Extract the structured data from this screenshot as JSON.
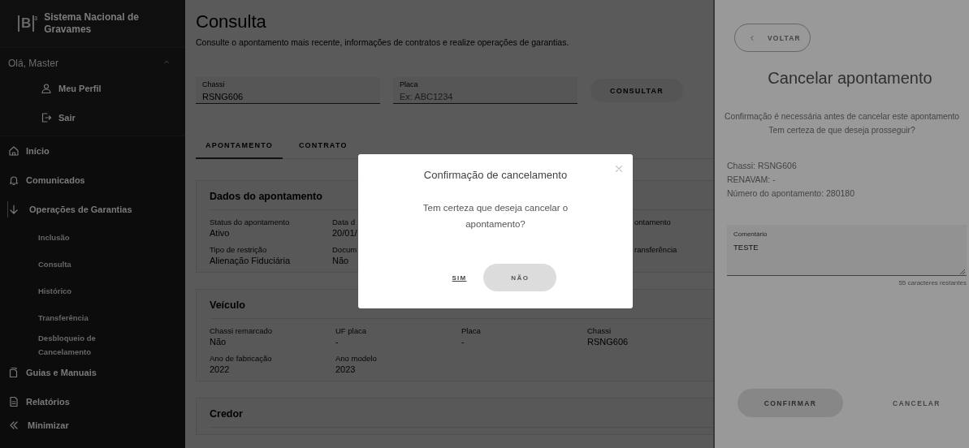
{
  "brand": {
    "logo_mark": "B",
    "logo_sup": "3",
    "name": "Sistema Nacional de Gravames"
  },
  "user": {
    "greeting": "Olá, Master",
    "expanded": true,
    "items": [
      {
        "label": "Meu Perfil"
      },
      {
        "label": "Sair"
      }
    ]
  },
  "nav": [
    {
      "label": "Início",
      "selected": false
    },
    {
      "label": "Comunicados",
      "selected": false
    },
    {
      "label": "Operações de Garantias",
      "selected": true,
      "children": [
        {
          "label": "Inclusão"
        },
        {
          "label": "Consulta"
        },
        {
          "label": "Histórico"
        },
        {
          "label": "Transferência"
        },
        {
          "label": "Desbloqueio de Cancelamento"
        }
      ]
    },
    {
      "label": "Guias e Manuais",
      "selected": false
    },
    {
      "label": "Relatórios",
      "selected": false
    }
  ],
  "minimize": "Minimizar",
  "main": {
    "title": "Consulta",
    "subtitle": "Consulte o apontamento mais recente, informações de contratos e realize operações de garantias.",
    "search_fields": [
      {
        "label": "Chassi",
        "value": "RSNG606"
      },
      {
        "label": "Placa",
        "placeholder": "Ex: ABC1234"
      }
    ],
    "search_button": "CONSULTAR",
    "tabs": [
      {
        "label": "APONTAMENTO",
        "selected": true
      },
      {
        "label": "CONTRATO",
        "selected": false
      }
    ],
    "cards": [
      {
        "title": "Dados do apontamento",
        "kind": "covered",
        "rows": [
          [
            {
              "label": "Status do apontamento",
              "value": "Ativo"
            },
            {
              "label": "Data d",
              "value": "20/01/"
            },
            {
              "label": "ontamento"
            }
          ],
          [
            {
              "label": "Tipo de restrição",
              "value": "Alienação Fiduciária"
            },
            {
              "label": "Docum",
              "value": "Não"
            },
            {
              "label": "ransferência"
            }
          ]
        ]
      },
      {
        "title": "Veículo",
        "kind": "full",
        "rows": [
          [
            {
              "label": "Chassi remarcado",
              "value": "Não"
            },
            {
              "label": "UF placa",
              "value": "-"
            },
            {
              "label": "Placa",
              "value": "-"
            },
            {
              "label": "Chassi",
              "value": "RSNG606"
            }
          ],
          [
            {
              "label": "Ano de fabricação",
              "value": "2022"
            },
            {
              "label": "Ano modelo",
              "value": "2023"
            }
          ]
        ]
      },
      {
        "title": "Credor",
        "kind": "full"
      }
    ]
  },
  "panel": {
    "back": "VOLTAR",
    "title": "Cancelar apontamento",
    "message": [
      "Confirmação é necessária antes de cancelar este apontamento",
      "Tem certeza de que deseja prosseguir?"
    ],
    "details": [
      "Chassi: RSNG606",
      "RENAVAM: -",
      "Número do apontamento: 280180"
    ],
    "comment": {
      "label": "Comentário",
      "value": "TESTE",
      "counter": "55 caracteres restantes"
    },
    "confirm": "CONFIRMAR",
    "cancel": "CANCELAR"
  },
  "dialog": {
    "title": "Confirmação de cancelamento",
    "message": "Tem certeza que deseja cancelar o apontamento?",
    "yes": "SIM",
    "no": "NÃO"
  }
}
